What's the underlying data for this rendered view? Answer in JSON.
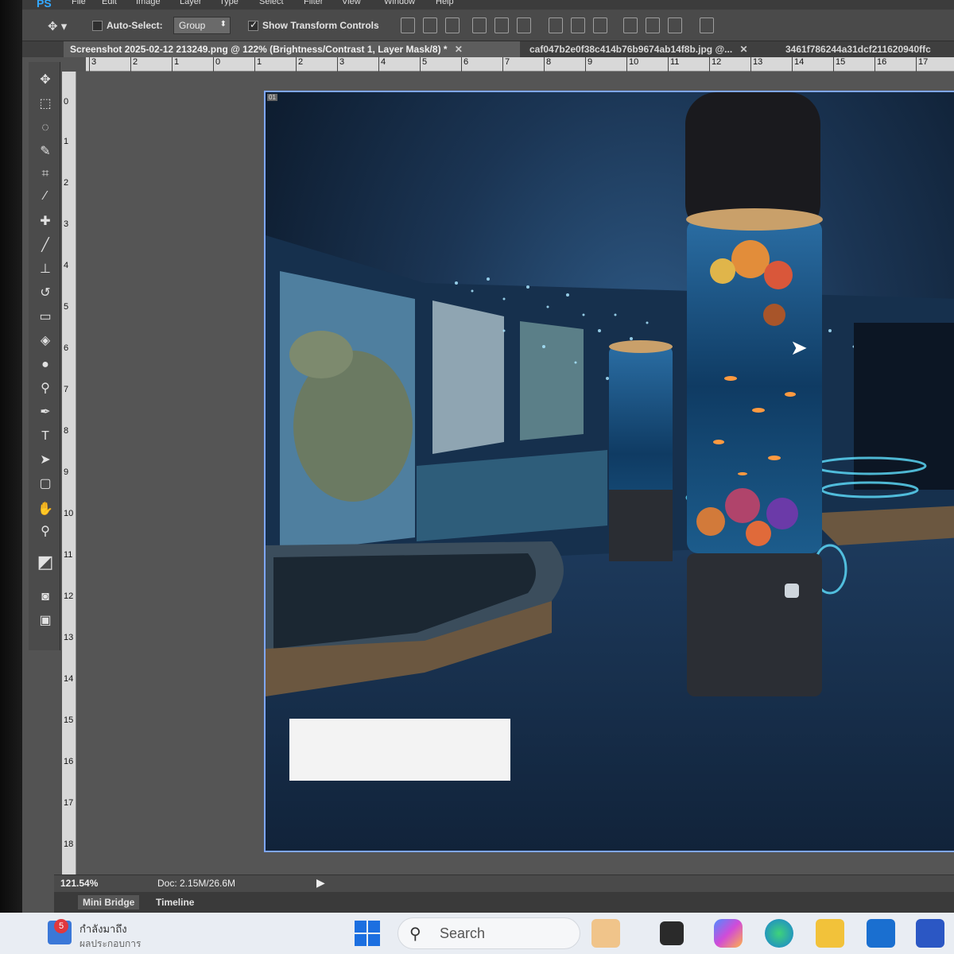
{
  "app": {
    "logo": "PS"
  },
  "menu": [
    "File",
    "Edit",
    "Image",
    "Layer",
    "Type",
    "Select",
    "Filter",
    "View",
    "Window",
    "Help"
  ],
  "options_bar": {
    "tool_icon": "move-tool-icon",
    "auto_select_label": "Auto-Select:",
    "auto_select_checked": false,
    "auto_select_value": "Group",
    "show_transform_label": "Show Transform Controls",
    "show_transform_checked": true
  },
  "tabs": [
    {
      "label": "Screenshot 2025-02-12 213249.png @ 122% (Brightness/Contrast 1, Layer Mask/8) *",
      "active": true
    },
    {
      "label": "caf047b2e0f38c414b76b9674ab14f8b.jpg @...",
      "active": false
    },
    {
      "label": "3461f786244a31dcf211620940ffc",
      "active": false
    }
  ],
  "ruler_top": [
    "3",
    "2",
    "1",
    "0",
    "1",
    "2",
    "3",
    "4",
    "5",
    "6",
    "7",
    "8",
    "9",
    "10",
    "11",
    "12",
    "13",
    "14",
    "15",
    "16",
    "17"
  ],
  "ruler_left": [
    "0",
    "1",
    "2",
    "3",
    "4",
    "5",
    "6",
    "7",
    "8",
    "9",
    "10",
    "11",
    "12",
    "13",
    "14",
    "15",
    "16",
    "17",
    "18"
  ],
  "tools": [
    "move-tool-icon",
    "marquee-tool-icon",
    "lasso-tool-icon",
    "quick-selection-tool-icon",
    "crop-tool-icon",
    "eyedropper-tool-icon",
    "spot-healing-tool-icon",
    "brush-tool-icon",
    "clone-stamp-tool-icon",
    "history-brush-tool-icon",
    "eraser-tool-icon",
    "paint-bucket-tool-icon",
    "blur-tool-icon",
    "dodge-tool-icon",
    "pen-tool-icon",
    "type-tool-icon",
    "path-selection-tool-icon",
    "rectangle-tool-icon",
    "hand-tool-icon",
    "zoom-tool-icon",
    "color-swatches-icon",
    "quick-mask-icon",
    "screen-mode-icon"
  ],
  "canvas_label": "01",
  "status": {
    "zoom": "121.54%",
    "doc": "Doc: 2.15M/26.6M"
  },
  "panel_tabs": [
    {
      "label": "Mini Bridge",
      "active": true
    },
    {
      "label": "Timeline",
      "active": false
    }
  ],
  "taskbar": {
    "badge": "5",
    "news_line1": "กำลังมาถึง",
    "news_line2": "ผลประกอบการ",
    "search_placeholder": "Search",
    "apps": [
      "widgets-icon",
      "task-view-icon",
      "copilot-icon",
      "edge-icon",
      "file-explorer-icon",
      "outlook-icon",
      "app-store-icon"
    ]
  }
}
